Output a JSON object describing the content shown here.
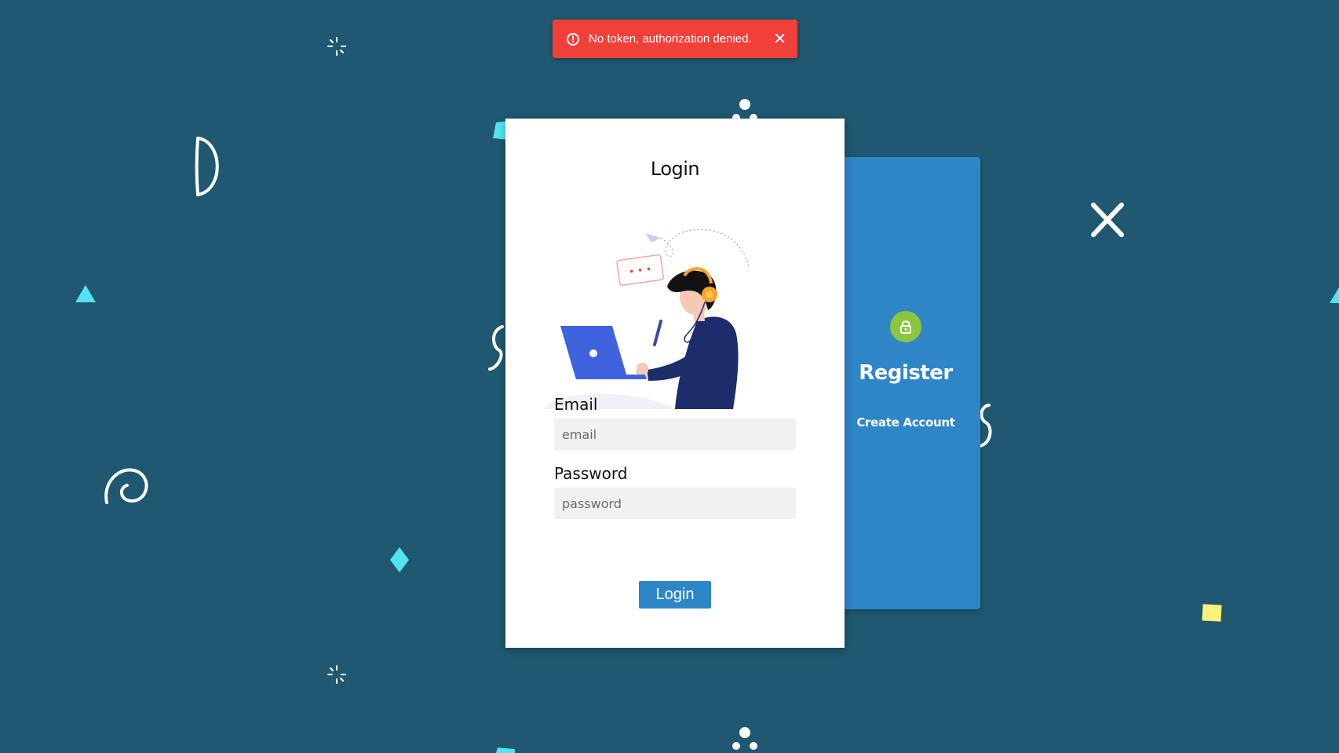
{
  "toast": {
    "message": "No token, authorization denied.",
    "icon": "error-circle-icon",
    "close_icon": "close-icon",
    "color": "#f1403a"
  },
  "login": {
    "title": "Login",
    "email_label": "Email",
    "email_placeholder": "email",
    "email_value": "",
    "password_label": "Password",
    "password_placeholder": "password",
    "password_value": "",
    "button_label": "Login"
  },
  "register": {
    "icon": "lock-icon",
    "title": "Register",
    "link_label": "Create Account"
  },
  "colors": {
    "background": "#1f5870",
    "accent": "#2e86c6",
    "lock_badge": "#8cc63e",
    "error": "#f1403a"
  }
}
